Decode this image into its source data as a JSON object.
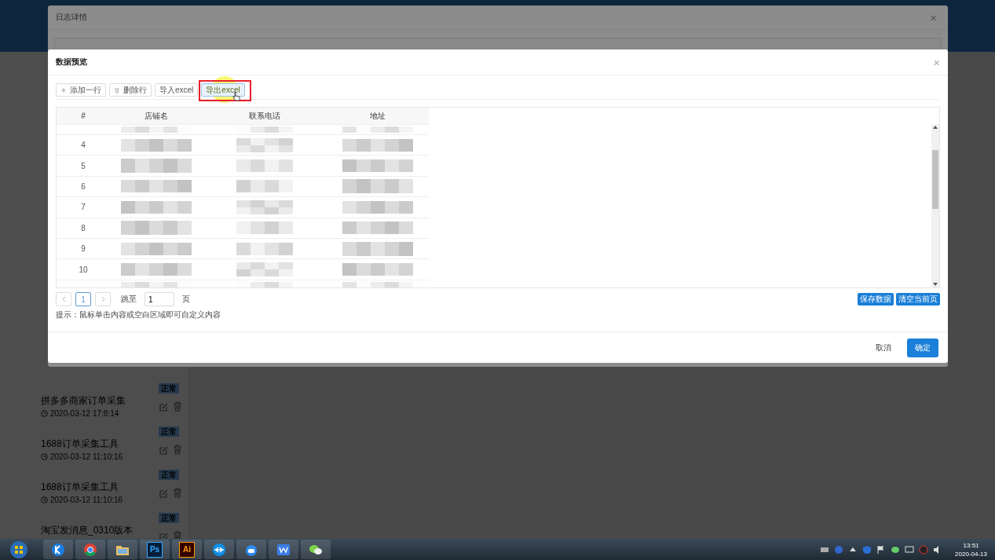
{
  "outer_dialog": {
    "title": "日志详情",
    "close": "×"
  },
  "background_list": [
    {
      "title": "拼多多商家订单采集",
      "time": "2020-03-12 17:8:14",
      "status": "正常"
    },
    {
      "title": "1688订单采集工具",
      "time": "2020-03-12 11:10:16",
      "status": "正常"
    },
    {
      "title": "1688订单采集工具",
      "time": "2020-03-12 11:10:16",
      "status": "正常"
    },
    {
      "title": "淘宝发消息_0310版本",
      "status": "正常"
    }
  ],
  "preview_dialog": {
    "title": "数据预览",
    "close": "×",
    "toolbar": [
      {
        "kind": "plus",
        "label": "添加一行",
        "highlighted": false
      },
      {
        "kind": "trash",
        "label": "删除行",
        "highlighted": false
      },
      {
        "kind": "plain",
        "label": "导入excel",
        "highlighted": false
      },
      {
        "kind": "plain",
        "label": "导出excel",
        "highlighted": true
      }
    ],
    "columns": [
      "#",
      "店铺名",
      "联系电话",
      "地址"
    ],
    "rows": [
      {
        "index": "4"
      },
      {
        "index": "5"
      },
      {
        "index": "6"
      },
      {
        "index": "7"
      },
      {
        "index": "8"
      },
      {
        "index": "9"
      },
      {
        "index": "10"
      }
    ],
    "pagination": {
      "current": "1",
      "jump_label": "跳至",
      "jump_value": "1",
      "page_unit": "页"
    },
    "hint": "提示：鼠标单击内容或空白区域即可自定义内容",
    "actions": [
      "保存数据",
      "清空当前页"
    ],
    "cancel": "取消",
    "confirm": "确定"
  },
  "taskbar": {
    "apps": [
      {
        "kind": "k"
      },
      {
        "kind": "chrome"
      },
      {
        "kind": "folder"
      },
      {
        "kind": "ps",
        "label": "Ps"
      },
      {
        "kind": "ai",
        "label": "Ai"
      },
      {
        "kind": "tv"
      },
      {
        "kind": "bot"
      },
      {
        "kind": "w"
      },
      {
        "kind": "chat"
      }
    ],
    "time": "13:51",
    "date": "2020-04-13"
  }
}
